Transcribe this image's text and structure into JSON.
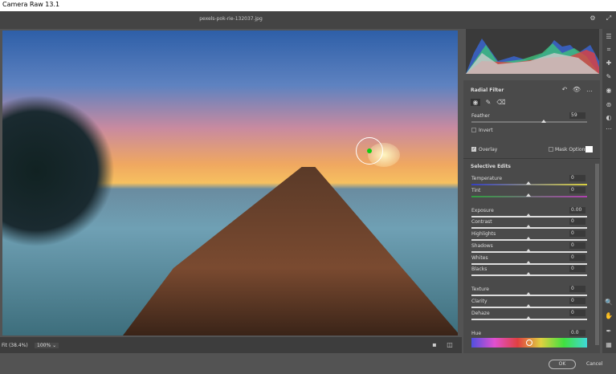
{
  "window": {
    "title": "Camera Raw 13.1"
  },
  "header": {
    "filename": "pexels-pok-rie-132037.jpg"
  },
  "canvas": {
    "zoom_fit": "Fit (38.4%)",
    "zoom_level": "100%"
  },
  "radial_filter": {
    "title": "Radial Filter",
    "feather_label": "Feather",
    "feather_value": "59",
    "feather": 59,
    "invert_label": "Invert",
    "invert": false,
    "overlay_label": "Overlay",
    "overlay": true,
    "mask_options_label": "Mask Options",
    "mask_options": false,
    "mask_color": "#ffffff"
  },
  "selective_edits": {
    "title": "Selective Edits",
    "sliders": [
      {
        "label": "Temperature",
        "value": "0"
      },
      {
        "label": "Tint",
        "value": "0"
      },
      {
        "label": "Exposure",
        "value": "0.00"
      },
      {
        "label": "Contrast",
        "value": "0"
      },
      {
        "label": "Highlights",
        "value": "0"
      },
      {
        "label": "Shadows",
        "value": "0"
      },
      {
        "label": "Whites",
        "value": "0"
      },
      {
        "label": "Blacks",
        "value": "0"
      },
      {
        "label": "Texture",
        "value": "0"
      },
      {
        "label": "Clarity",
        "value": "0"
      },
      {
        "label": "Dehaze",
        "value": "0"
      },
      {
        "label": "Hue",
        "value": "0.0"
      }
    ]
  },
  "footer": {
    "ok": "OK",
    "cancel": "Cancel"
  },
  "icons": {
    "settings": "gear-icon",
    "fullscreen": "expand-icon",
    "tools": [
      "edit-sliders-icon",
      "crop-icon",
      "healing-brush-icon",
      "adjustment-brush-icon",
      "graduated-filter-icon",
      "radial-filter-icon",
      "red-eye-icon",
      "presets-icon",
      "more-icon",
      "zoom-icon",
      "hand-icon",
      "eyedropper-icon",
      "grid-icon"
    ]
  }
}
